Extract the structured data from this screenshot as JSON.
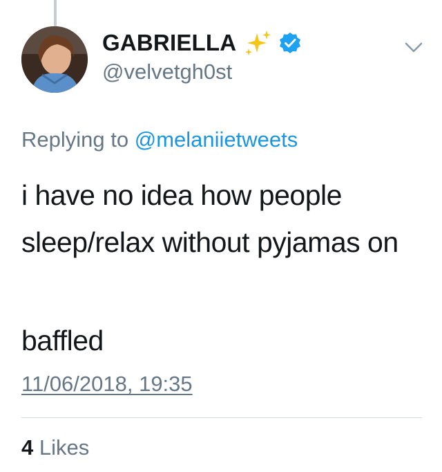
{
  "tweet": {
    "display_name": "GABRIELLA",
    "handle": "@velvetgh0st",
    "reply_prefix": "Replying to",
    "reply_mention": "@melaniietweets",
    "text": "i have no idea how people sleep/relax without pyjamas on",
    "text2": "baffled",
    "timestamp": "11/06/2018, 19:35",
    "likes_count": "4",
    "likes_label": "Likes"
  },
  "colors": {
    "link": "#1b95e0",
    "secondary_text": "#657786",
    "primary_text": "#14171a",
    "verified": "#1da1f2",
    "sparkle": "#f5c518"
  },
  "icons": {
    "verified": "verified-badge-icon",
    "sparkles": "sparkles-emoji-icon",
    "menu": "chevron-down-icon"
  }
}
